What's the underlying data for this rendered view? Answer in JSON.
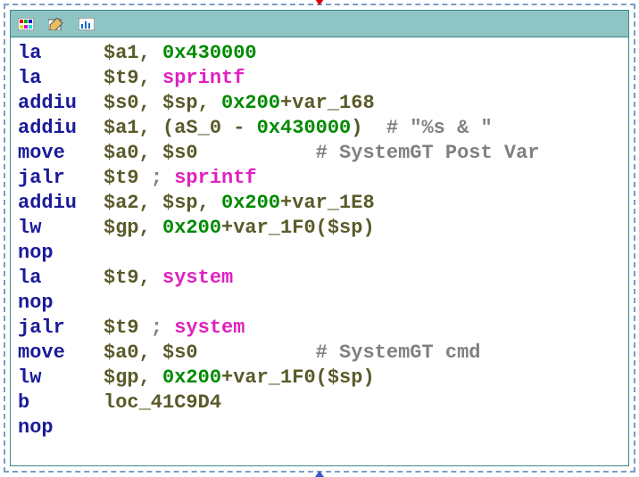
{
  "toolbar": {
    "icons": [
      "palette-icon",
      "edit-icon",
      "stats-icon"
    ]
  },
  "colors": {
    "mnemonic": "#1a1a9a",
    "register": "#5a5a2a",
    "number": "#008a00",
    "function": "#e020c0",
    "comment": "#808080"
  },
  "code": [
    {
      "mnem": "la",
      "tokens": [
        {
          "t": "reg",
          "v": "$a1"
        },
        {
          "t": "punct",
          "v": ", "
        },
        {
          "t": "num",
          "v": "0x430000"
        }
      ]
    },
    {
      "mnem": "la",
      "tokens": [
        {
          "t": "reg",
          "v": "$t9"
        },
        {
          "t": "punct",
          "v": ", "
        },
        {
          "t": "func",
          "v": "sprintf"
        }
      ]
    },
    {
      "mnem": "addiu",
      "tokens": [
        {
          "t": "reg",
          "v": "$s0"
        },
        {
          "t": "punct",
          "v": ", "
        },
        {
          "t": "reg",
          "v": "$sp"
        },
        {
          "t": "punct",
          "v": ", "
        },
        {
          "t": "num",
          "v": "0x200"
        },
        {
          "t": "reg",
          "v": "+var_168"
        }
      ]
    },
    {
      "mnem": "addiu",
      "tokens": [
        {
          "t": "reg",
          "v": "$a1"
        },
        {
          "t": "punct",
          "v": ", ("
        },
        {
          "t": "reg",
          "v": "aS_0"
        },
        {
          "t": "punct",
          "v": " - "
        },
        {
          "t": "num",
          "v": "0x430000"
        },
        {
          "t": "punct",
          "v": ")  "
        },
        {
          "t": "comment",
          "v": "# \"%s & \""
        }
      ]
    },
    {
      "mnem": "move",
      "tokens": [
        {
          "t": "reg",
          "v": "$a0"
        },
        {
          "t": "punct",
          "v": ", "
        },
        {
          "t": "reg",
          "v": "$s0"
        },
        {
          "t": "punct",
          "v": "          "
        },
        {
          "t": "comment",
          "v": "# SystemGT Post Var"
        }
      ]
    },
    {
      "mnem": "jalr",
      "tokens": [
        {
          "t": "reg",
          "v": "$t9 "
        },
        {
          "t": "comment",
          "v": "; "
        },
        {
          "t": "func",
          "v": "sprintf"
        }
      ]
    },
    {
      "mnem": "addiu",
      "tokens": [
        {
          "t": "reg",
          "v": "$a2"
        },
        {
          "t": "punct",
          "v": ", "
        },
        {
          "t": "reg",
          "v": "$sp"
        },
        {
          "t": "punct",
          "v": ", "
        },
        {
          "t": "num",
          "v": "0x200"
        },
        {
          "t": "reg",
          "v": "+var_1E8"
        }
      ]
    },
    {
      "mnem": "lw",
      "tokens": [
        {
          "t": "reg",
          "v": "$gp"
        },
        {
          "t": "punct",
          "v": ", "
        },
        {
          "t": "num",
          "v": "0x200"
        },
        {
          "t": "reg",
          "v": "+var_1F0"
        },
        {
          "t": "punct",
          "v": "("
        },
        {
          "t": "reg",
          "v": "$sp"
        },
        {
          "t": "punct",
          "v": ")"
        }
      ]
    },
    {
      "mnem": "nop",
      "tokens": []
    },
    {
      "mnem": "la",
      "tokens": [
        {
          "t": "reg",
          "v": "$t9"
        },
        {
          "t": "punct",
          "v": ", "
        },
        {
          "t": "func",
          "v": "system"
        }
      ]
    },
    {
      "mnem": "nop",
      "tokens": []
    },
    {
      "mnem": "jalr",
      "tokens": [
        {
          "t": "reg",
          "v": "$t9 "
        },
        {
          "t": "comment",
          "v": "; "
        },
        {
          "t": "func",
          "v": "system"
        }
      ]
    },
    {
      "mnem": "move",
      "tokens": [
        {
          "t": "reg",
          "v": "$a0"
        },
        {
          "t": "punct",
          "v": ", "
        },
        {
          "t": "reg",
          "v": "$s0"
        },
        {
          "t": "punct",
          "v": "          "
        },
        {
          "t": "comment",
          "v": "# SystemGT cmd"
        }
      ]
    },
    {
      "mnem": "lw",
      "tokens": [
        {
          "t": "reg",
          "v": "$gp"
        },
        {
          "t": "punct",
          "v": ", "
        },
        {
          "t": "num",
          "v": "0x200"
        },
        {
          "t": "reg",
          "v": "+var_1F0"
        },
        {
          "t": "punct",
          "v": "("
        },
        {
          "t": "reg",
          "v": "$sp"
        },
        {
          "t": "punct",
          "v": ")"
        }
      ]
    },
    {
      "mnem": "b",
      "tokens": [
        {
          "t": "reg",
          "v": "loc_41C9D4"
        }
      ]
    },
    {
      "mnem": "nop",
      "tokens": []
    }
  ]
}
